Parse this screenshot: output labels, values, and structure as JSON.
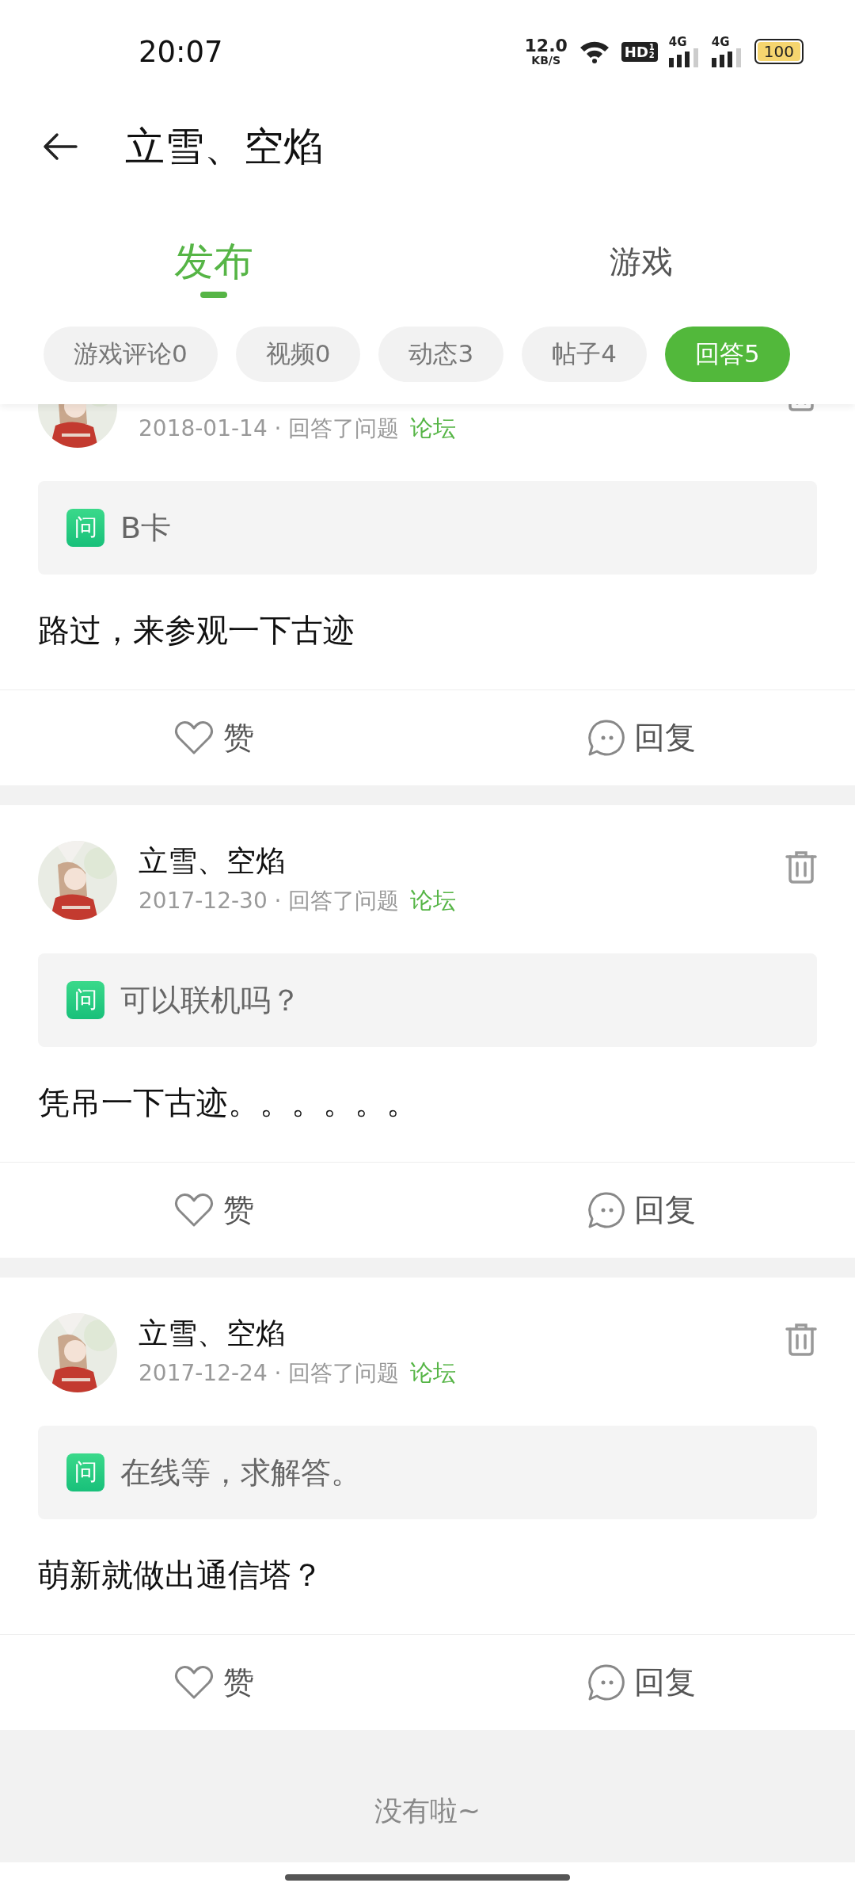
{
  "status_bar": {
    "time": "20:07",
    "speed": "12.0",
    "speed_unit": "KB/S",
    "hd": "HD",
    "hd_slots": [
      "1",
      "2"
    ],
    "networks": [
      {
        "label": "4G"
      },
      {
        "label": "4G"
      }
    ],
    "battery": "100"
  },
  "header": {
    "title": "立雪、空焰"
  },
  "tabs": [
    {
      "label": "发布",
      "selected": true
    },
    {
      "label": "游戏",
      "selected": false
    }
  ],
  "filters": [
    {
      "label": "游戏评论0",
      "selected": false
    },
    {
      "label": "视频0",
      "selected": false
    },
    {
      "label": "动态3",
      "selected": false
    },
    {
      "label": "帖子4",
      "selected": false
    },
    {
      "label": "回答5",
      "selected": true
    }
  ],
  "answers": [
    {
      "meta": "2018-01-14 · 回答了问题",
      "source": "论坛",
      "badge": "问",
      "question": "B卡",
      "answer": "路过，来参观一下古迹",
      "like": "赞",
      "reply": "回复"
    },
    {
      "name": "立雪、空焰",
      "meta": "2017-12-30 · 回答了问题",
      "source": "论坛",
      "badge": "问",
      "question": "可以联机吗？",
      "answer": "凭吊一下古迹。。。。。。",
      "like": "赞",
      "reply": "回复"
    },
    {
      "name": "立雪、空焰",
      "meta": "2017-12-24 · 回答了问题",
      "source": "论坛",
      "badge": "问",
      "question": "在线等，求解答。",
      "answer": "萌新就做出通信塔？",
      "like": "赞",
      "reply": "回复"
    }
  ],
  "footer": "没有啦~"
}
